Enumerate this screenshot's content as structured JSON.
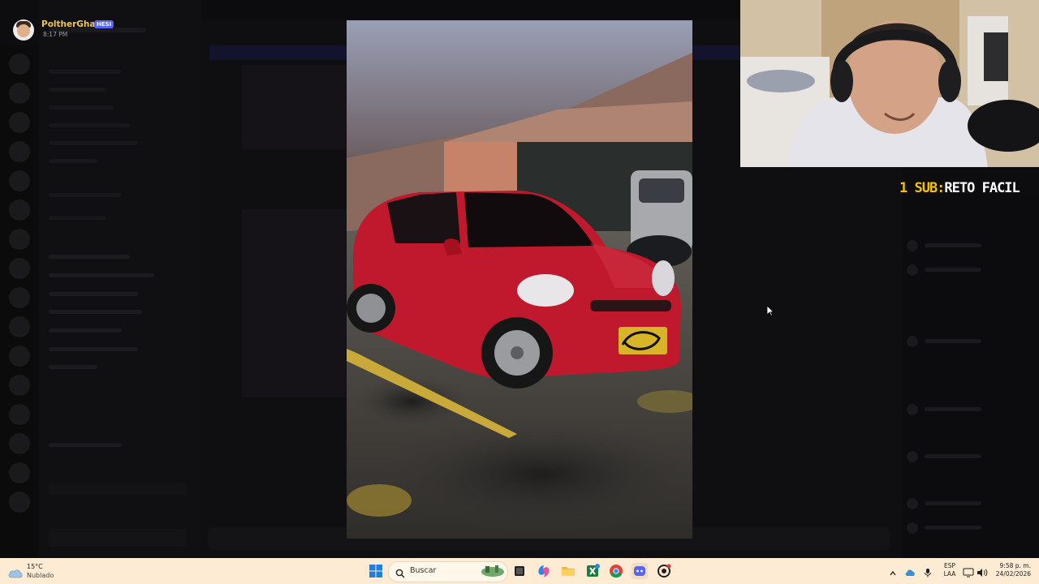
{
  "user_tag": {
    "name": "PoltherGhast",
    "badge": "HESI",
    "time": "8:17 PM"
  },
  "stream_overlay": {
    "sub_count": "1 SUB:",
    "sub_text": "RETO FACIL"
  },
  "taskbar": {
    "weather_temp": "15°C",
    "weather_desc": "Nublado",
    "search_placeholder": "Buscar",
    "language_line1": "ESP",
    "language_line2": "LAA",
    "time": "9:58 p. m.",
    "date": "24/02/2026",
    "apps": [
      "widgets-icon",
      "task-view-icon",
      "copilot-icon",
      "file-explorer-icon",
      "excel-icon",
      "chrome-icon",
      "discord-icon",
      "obs-icon"
    ],
    "tray_icons": [
      "chevron-up-icon",
      "network-cloud-icon",
      "mic-icon",
      "monitor-icon",
      "speaker-icon"
    ]
  },
  "colors": {
    "taskbar_bg": "#fdebd3",
    "username": "#f0c848",
    "sub_highlight": "#f1c20a",
    "car_red": "#c0182c"
  }
}
